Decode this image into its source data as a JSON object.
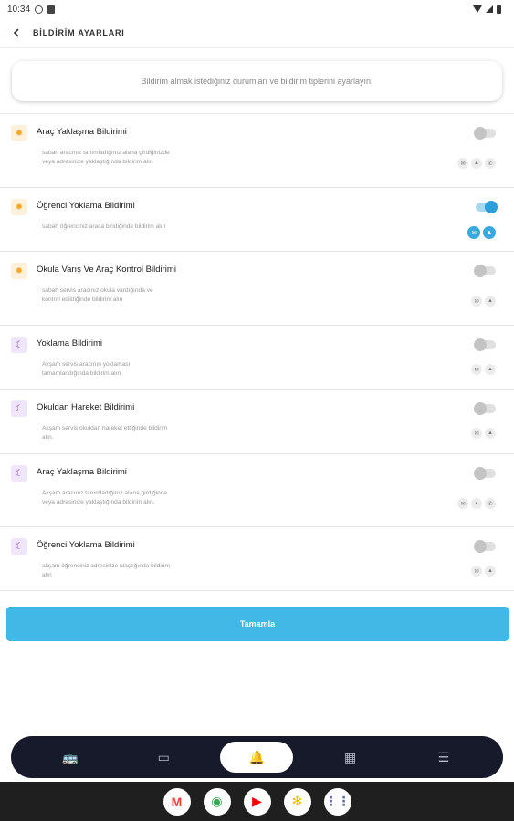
{
  "status_bar": {
    "time": "10:34"
  },
  "header": {
    "title": "BİLDİRİM AYARLARI"
  },
  "info": {
    "text": "Bildirim almak istediğiniz durumları ve bildirim tiplerini ayarlayın."
  },
  "items": [
    {
      "icon": "sun-icon",
      "title": "Araç Yaklaşma Bildirimi",
      "desc": "sabah aracınız tanımladığınız alana girdiğinizde veya adresinize yaklaştığında bildirim alın",
      "enabled": false,
      "channels": [
        "sms-icon",
        "bell-icon",
        "phone-icon"
      ]
    },
    {
      "icon": "sun-icon",
      "title": "Öğrenci Yoklama Bildirimi",
      "desc": "sabah öğrenciniz araca bindiğinde bildirim alın",
      "enabled": true,
      "channels": [
        "sms-icon",
        "bell-icon"
      ]
    },
    {
      "icon": "sun-icon",
      "title": "Okula Varış Ve Araç Kontrol Bildirimi",
      "desc": "sabah servis aracınız okula vardığında ve kontrol edildiğinde bildirim alın",
      "enabled": false,
      "channels": [
        "sms-icon",
        "bell-icon"
      ]
    },
    {
      "icon": "moon-icon",
      "title": "Yoklama Bildirimi",
      "desc": "Akşam servis aracının yoklaması tamamlandığında bildirim alın.",
      "enabled": false,
      "channels": [
        "sms-icon",
        "bell-icon"
      ]
    },
    {
      "icon": "moon-icon",
      "title": "Okuldan Hareket Bildirimi",
      "desc": "Akşam servis okuldan hareket ettiğinde bildirim alın.",
      "enabled": false,
      "channels": [
        "sms-icon",
        "bell-icon"
      ]
    },
    {
      "icon": "moon-icon",
      "title": "Araç Yaklaşma Bildirimi",
      "desc": "Akşam aracınız tanımladığınız alana girdiğinde veya adresinize yaklaştığında bildirim alın.",
      "enabled": false,
      "channels": [
        "sms-icon",
        "bell-icon",
        "phone-icon"
      ]
    },
    {
      "icon": "moon-icon",
      "title": "Öğrenci Yoklama Bildirimi",
      "desc": "akşam öğrenciniz adresinize ulaştığında bildirim alın",
      "enabled": false,
      "channels": [
        "sms-icon",
        "bell-icon"
      ]
    }
  ],
  "done_button": {
    "label": "Tamamla"
  },
  "bottom_nav": [
    {
      "name": "bus-icon",
      "glyph": "🚌",
      "active": false
    },
    {
      "name": "card-icon",
      "glyph": "▭",
      "active": false
    },
    {
      "name": "bell-icon",
      "glyph": "🔔",
      "active": true
    },
    {
      "name": "calendar-icon",
      "glyph": "▦",
      "active": false
    },
    {
      "name": "menu-icon",
      "glyph": "☰",
      "active": false
    }
  ],
  "dock": [
    {
      "name": "gmail-icon",
      "glyph": "M",
      "color": "#ea4335"
    },
    {
      "name": "chrome-icon",
      "glyph": "◉",
      "color": "#34a853"
    },
    {
      "name": "youtube-icon",
      "glyph": "▶",
      "color": "#ff0000"
    },
    {
      "name": "photos-icon",
      "glyph": "✻",
      "color": "#fbbc05"
    },
    {
      "name": "apps-icon",
      "glyph": "⋮⋮",
      "color": "#5f6aa8"
    }
  ],
  "colors": {
    "accent": "#42b8e6",
    "nav_bg": "#171a2b",
    "sun": "#f5a623",
    "moon": "#8b3fd8"
  }
}
